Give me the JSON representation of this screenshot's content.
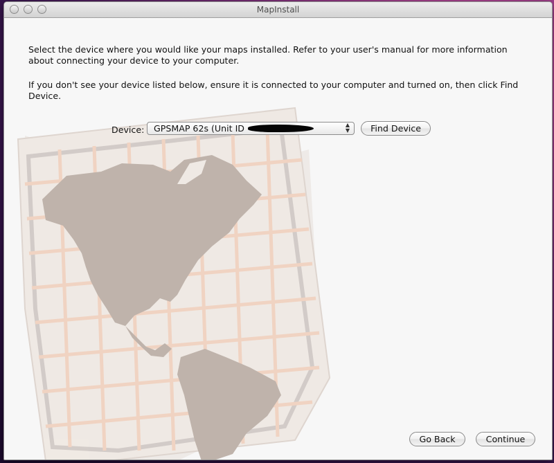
{
  "window": {
    "title": "MapInstall"
  },
  "instructions": {
    "paragraph1": "Select the device where you would like your maps installed. Refer to your user's manual for more information about connecting your device to your computer.",
    "paragraph2": "If you don't see your device listed below, ensure it is connected to your computer and turned on, then click Find Device."
  },
  "device": {
    "label": "Device:",
    "selected": "GPSMAP 62s (Unit ID",
    "find_button": "Find Device"
  },
  "footer": {
    "back_label": "Go Back",
    "continue_label": "Continue"
  },
  "icons": [
    "close-icon",
    "minimize-icon",
    "zoom-icon",
    "popup-arrows-icon",
    "world-map-illustration"
  ],
  "colors": {
    "window_bg": "#f7f7f7",
    "map_land": "#b9aca3",
    "map_paper": "#efe8e2",
    "map_grid": "#f0d3c2"
  }
}
